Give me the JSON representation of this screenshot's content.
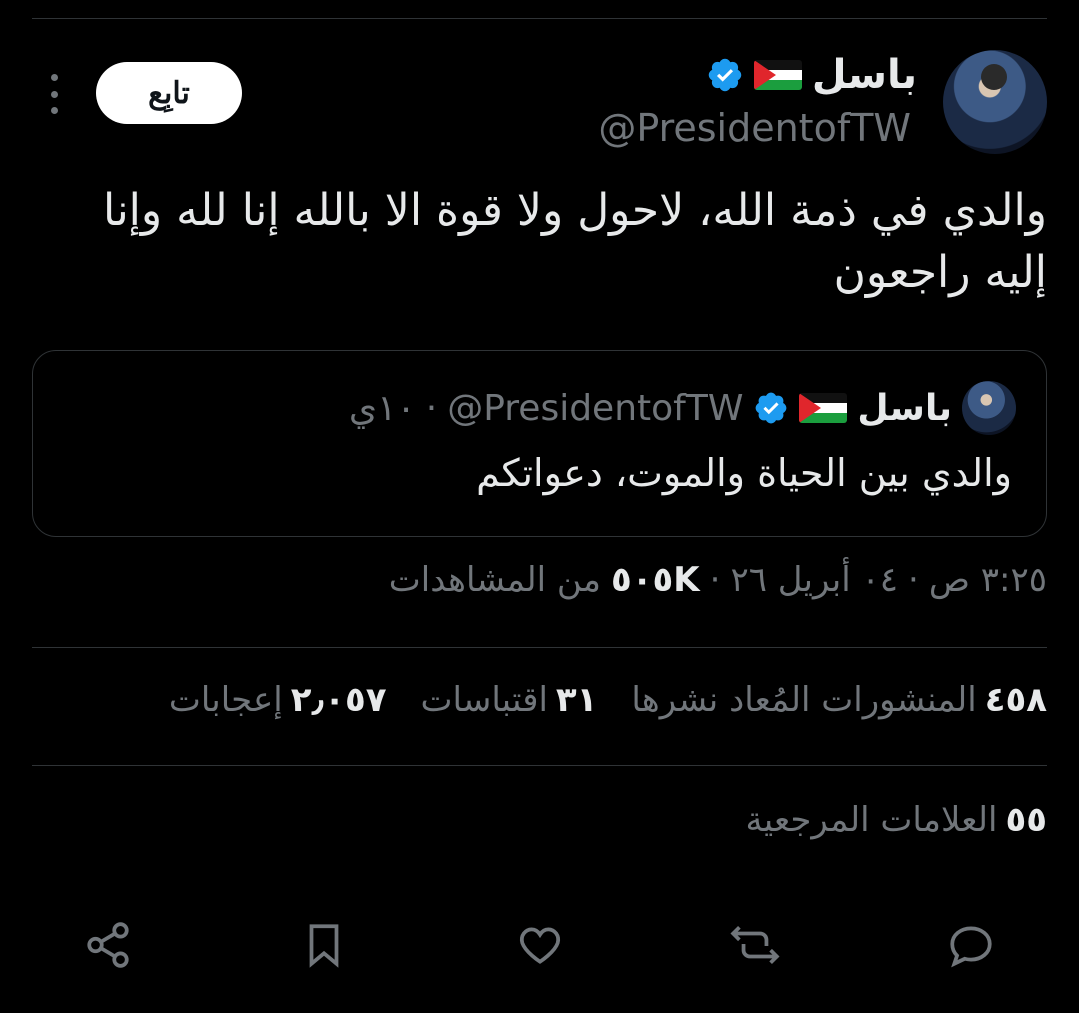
{
  "tweet": {
    "author": {
      "name": "باسل",
      "flag": "palestine-flag-icon",
      "verified": true,
      "handle": "@PresidentofTW"
    },
    "follow_label": "تابِع",
    "text": "والدي في ذمة الله، لاحول ولا قوة الا بالله إنا لله وإنا إليه راجعون"
  },
  "quote": {
    "author_name": "باسل",
    "handle": "@PresidentofTW",
    "separator": "·",
    "time": "١٠ي",
    "text": "والدي بين الحياة والموت، دعواتكم"
  },
  "meta": {
    "time": "٣:٢٥ ص",
    "sep1": "·",
    "date": "٠٤ أبريل ٢٦",
    "sep2": "·",
    "views_count": "٥٠٥K",
    "views_label": "من المشاهدات"
  },
  "stats": {
    "reposts_count": "٤٥٨",
    "reposts_label": "المنشورات المُعاد نشرها",
    "quotes_count": "٣١",
    "quotes_label": "اقتباسات",
    "likes_count": "٢٫٠٥٧",
    "likes_label": "إعجابات"
  },
  "bookmarks": {
    "count": "٥٥",
    "label": "العلامات المرجعية"
  },
  "colors": {
    "background": "#000000",
    "text": "#e7e9ea",
    "muted": "#71767b",
    "border": "#2f3336",
    "verified": "#1d9bf0"
  }
}
